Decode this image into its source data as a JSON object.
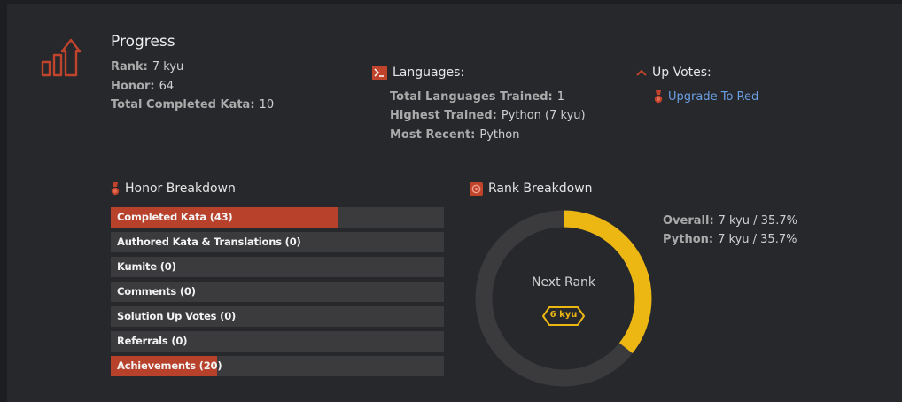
{
  "progress": {
    "title": "Progress",
    "icon": "progress-chart-icon",
    "rank_label": "Rank:",
    "rank_value": "7 kyu",
    "honor_label": "Honor:",
    "honor_value": "64",
    "completed_label": "Total Completed Kata:",
    "completed_value": "10"
  },
  "languages": {
    "heading": "Languages:",
    "icon": "terminal-icon",
    "trained_label": "Total Languages Trained:",
    "trained_value": "1",
    "highest_label": "Highest Trained:",
    "highest_value": "Python (7 kyu)",
    "recent_label": "Most Recent:",
    "recent_value": "Python"
  },
  "upvotes": {
    "heading": "Up Votes:",
    "icon": "chevron-up-icon",
    "link_label": "Upgrade To Red",
    "link_icon": "medal-icon"
  },
  "honor_breakdown": {
    "heading": "Honor Breakdown",
    "icon": "medal-icon",
    "items": [
      {
        "label": "Completed Kata (43)",
        "fill": 0.68
      },
      {
        "label": "Authored Kata & Translations (0)",
        "fill": 0
      },
      {
        "label": "Kumite (0)",
        "fill": 0
      },
      {
        "label": "Comments (0)",
        "fill": 0
      },
      {
        "label": "Solution Up Votes (0)",
        "fill": 0
      },
      {
        "label": "Referrals (0)",
        "fill": 0
      },
      {
        "label": "Achievements (20)",
        "fill": 0.32
      }
    ]
  },
  "rank_breakdown": {
    "heading": "Rank Breakdown",
    "icon": "target-icon",
    "progress_fraction": 0.357,
    "next_rank_label": "Next Rank",
    "next_rank_badge": "6 kyu",
    "overall_label": "Overall:",
    "overall_value": "7 kyu / 35.7%",
    "python_label": "Python:",
    "python_value": "7 kyu / 35.7%"
  },
  "colors": {
    "accent_red": "#b8412b",
    "rank_yellow": "#ecb613",
    "link_blue": "#6a9ee2",
    "track": "#3b3b3e"
  }
}
